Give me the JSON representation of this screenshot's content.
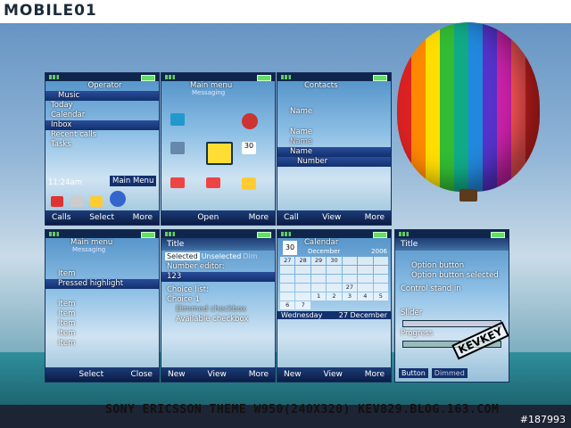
{
  "brand": "MOBILE01",
  "footer": {
    "theme": "SONY ERICSSON THEME W950(240X320)   KEV829.BLOG.163.COM",
    "id": "#187993"
  },
  "watermark": "KEVKEY",
  "p1": {
    "operator": "Operator",
    "music": "Music",
    "today": "Today",
    "calendar": "Calendar",
    "inbox": "Inbox",
    "recent": "Recent calls",
    "tasks": "Tasks",
    "time": "11:24am",
    "mainmenu": "Main Menu",
    "keys": [
      "Calls",
      "Select",
      "More"
    ]
  },
  "p2": {
    "title": "Main menu",
    "sub": "Messaging",
    "cal": "30",
    "keys": [
      "",
      "Open",
      "More"
    ]
  },
  "p3": {
    "title": "Contacts",
    "names": [
      "Name",
      "Name",
      "Name",
      "Name"
    ],
    "number": "Number",
    "keys": [
      "Call",
      "View",
      "More"
    ]
  },
  "p4": {
    "title": "Main menu",
    "sub": "Messaging",
    "item": "Item",
    "pressed": "Pressed highlight",
    "items": [
      "Item",
      "Item",
      "Item",
      "Item",
      "Item"
    ],
    "keys": [
      "",
      "Select",
      "Close"
    ]
  },
  "p5": {
    "title": "Title",
    "tabs": [
      "Selected",
      "Unselected",
      "Dim"
    ],
    "editor_label": "Number editor:",
    "editor_value": "123",
    "choice_label": "Choice list:",
    "choice_value": "Choice 1",
    "dimmed": "Dimmed checkbox",
    "available": "Available checkbox",
    "keys": [
      "New",
      "View",
      "More"
    ]
  },
  "p6": {
    "title": "Calendar",
    "month": "December",
    "year": "2006",
    "days": [
      "Wednesday",
      "27 December"
    ],
    "grid": [
      "27",
      "28",
      "29",
      "30",
      "",
      "",
      "",
      "",
      "",
      "",
      "",
      "",
      "",
      "",
      "",
      "",
      "",
      "",
      "",
      "",
      "",
      "",
      "",
      "",
      "",
      "27",
      "",
      "",
      "",
      "",
      "1",
      "2",
      "3",
      "4",
      "5",
      "6",
      "7"
    ],
    "cal": "30",
    "keys": [
      "New",
      "View",
      "More"
    ]
  },
  "p7": {
    "title": "Title",
    "opt": "Option button",
    "opt_sel": "Option button selected",
    "control": "Control stand in",
    "slider": "Slider",
    "progress": "Progress",
    "button": "Button",
    "dimmed": "Dimmed"
  }
}
